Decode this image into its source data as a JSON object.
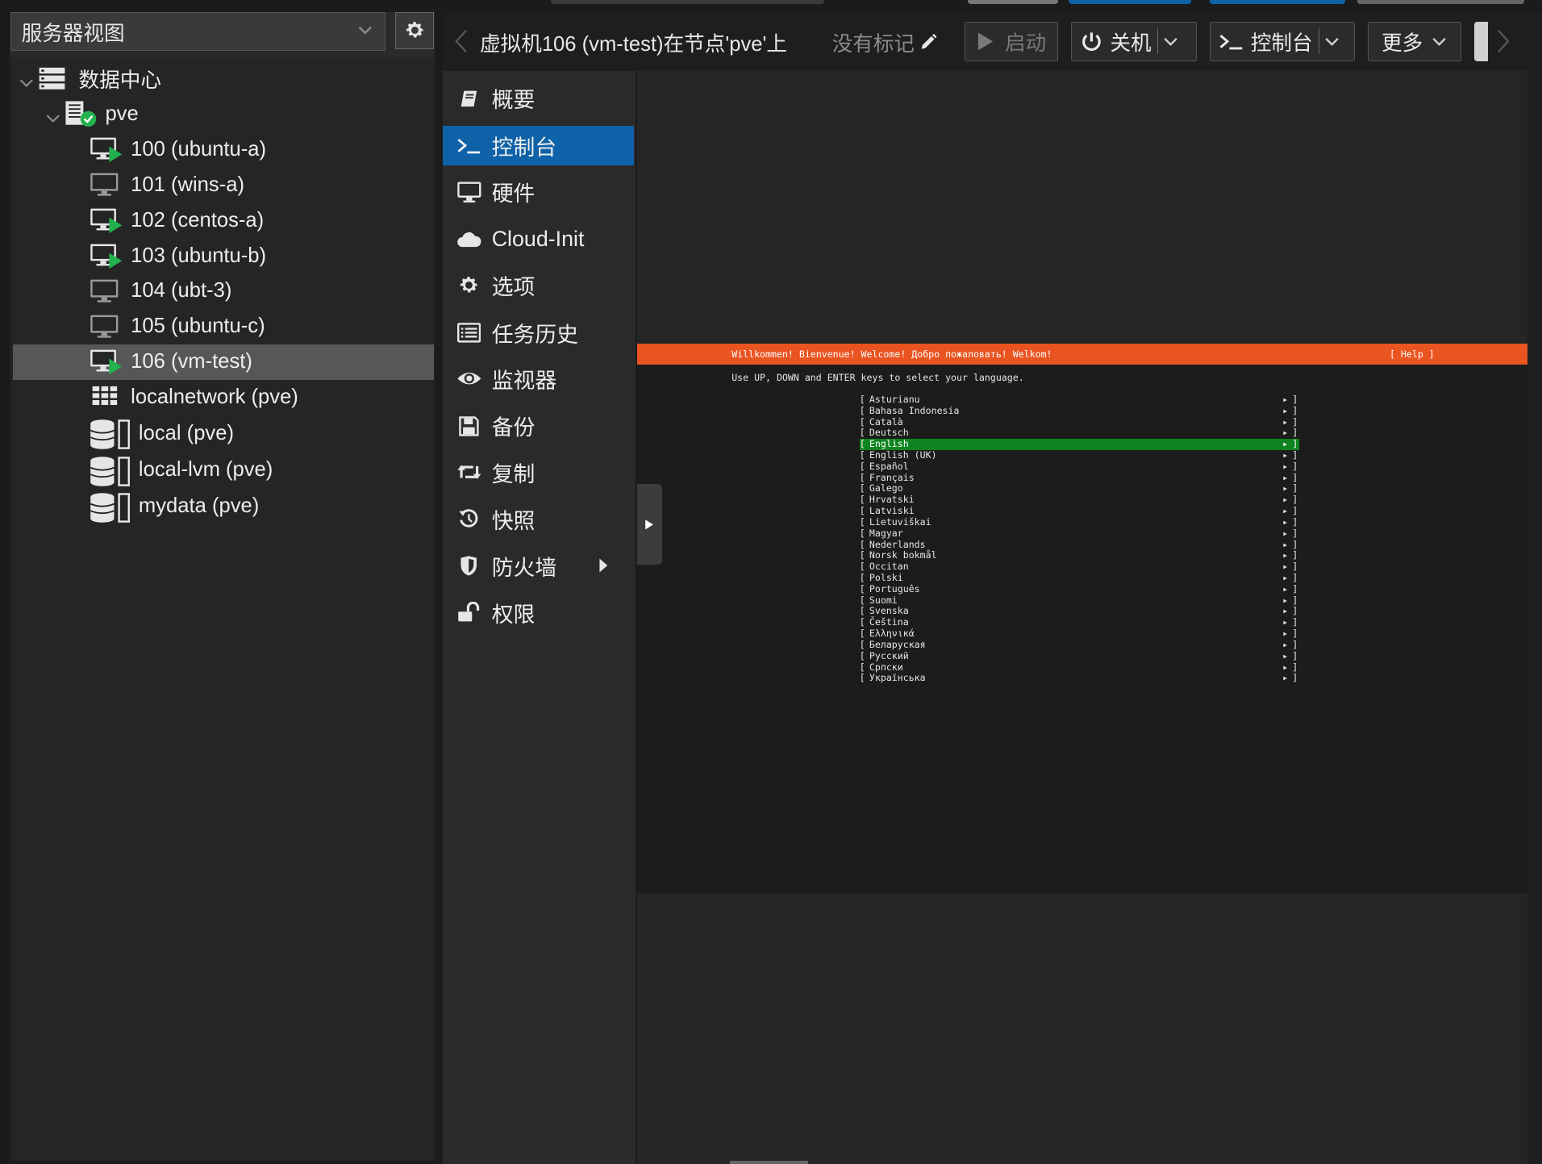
{
  "view_selector": {
    "label": "服务器视图"
  },
  "tree": {
    "items": [
      {
        "label": "数据中心",
        "type": "datacenter",
        "level": 0
      },
      {
        "label": "pve",
        "type": "node",
        "level": 1
      },
      {
        "label": "100 (ubuntu-a)",
        "type": "vm-running",
        "level": 2
      },
      {
        "label": "101 (wins-a)",
        "type": "vm-stopped",
        "level": 2
      },
      {
        "label": "102 (centos-a)",
        "type": "vm-running",
        "level": 2
      },
      {
        "label": "103 (ubuntu-b)",
        "type": "vm-running",
        "level": 2
      },
      {
        "label": "104 (ubt-3)",
        "type": "vm-stopped",
        "level": 2
      },
      {
        "label": "105 (ubuntu-c)",
        "type": "vm-stopped",
        "level": 2
      },
      {
        "label": "106 (vm-test)",
        "type": "vm-running",
        "level": 2,
        "selected": true
      },
      {
        "label": "localnetwork (pve)",
        "type": "network",
        "level": 2
      },
      {
        "label": "local (pve)",
        "type": "storage",
        "level": 2
      },
      {
        "label": "local-lvm (pve)",
        "type": "storage",
        "level": 2
      },
      {
        "label": "mydata (pve)",
        "type": "storage",
        "level": 2
      }
    ]
  },
  "header": {
    "title": "虚拟机106 (vm-test)在节点'pve'上",
    "tags": "没有标记",
    "buttons": {
      "start": "启动",
      "shutdown": "关机",
      "console": "控制台",
      "more": "更多"
    }
  },
  "menu": {
    "items": [
      {
        "label": "概要",
        "icon": "book-icon"
      },
      {
        "label": "控制台",
        "icon": "terminal-icon",
        "selected": true
      },
      {
        "label": "硬件",
        "icon": "monitor-icon"
      },
      {
        "label": "Cloud-Init",
        "icon": "cloud-icon"
      },
      {
        "label": "选项",
        "icon": "gear-icon"
      },
      {
        "label": "任务历史",
        "icon": "list-icon"
      },
      {
        "label": "监视器",
        "icon": "eye-icon"
      },
      {
        "label": "备份",
        "icon": "floppy-icon"
      },
      {
        "label": "复制",
        "icon": "retweet-icon"
      },
      {
        "label": "快照",
        "icon": "history-icon"
      },
      {
        "label": "防火墙",
        "icon": "shield-icon",
        "has_submenu": true
      },
      {
        "label": "权限",
        "icon": "unlock-icon"
      }
    ]
  },
  "console": {
    "welcome": "Willkommen! Bienvenue! Welcome! Добро пожаловать! Welkom!",
    "help": "[ Help ]",
    "instruction": "Use UP, DOWN and ENTER keys to select your language.",
    "languages": [
      "Asturianu",
      "Bahasa Indonesia",
      "Català",
      "Deutsch",
      "English",
      "English (UK)",
      "Español",
      "Français",
      "Galego",
      "Hrvatski",
      "Latviski",
      "Lietuviškai",
      "Magyar",
      "Nederlands",
      "Norsk bokmål",
      "Occitan",
      "Polski",
      "Português",
      "Suomi",
      "Svenska",
      "Čeština",
      "Ελληνικά",
      "Беларуская",
      "Русский",
      "Српски",
      "Українська"
    ],
    "selected_language": "English",
    "accent_color": "#e95420",
    "highlight_color": "#0e8420"
  },
  "colors": {
    "selection_blue": "#0e62a8",
    "running_green": "#22b14c"
  }
}
